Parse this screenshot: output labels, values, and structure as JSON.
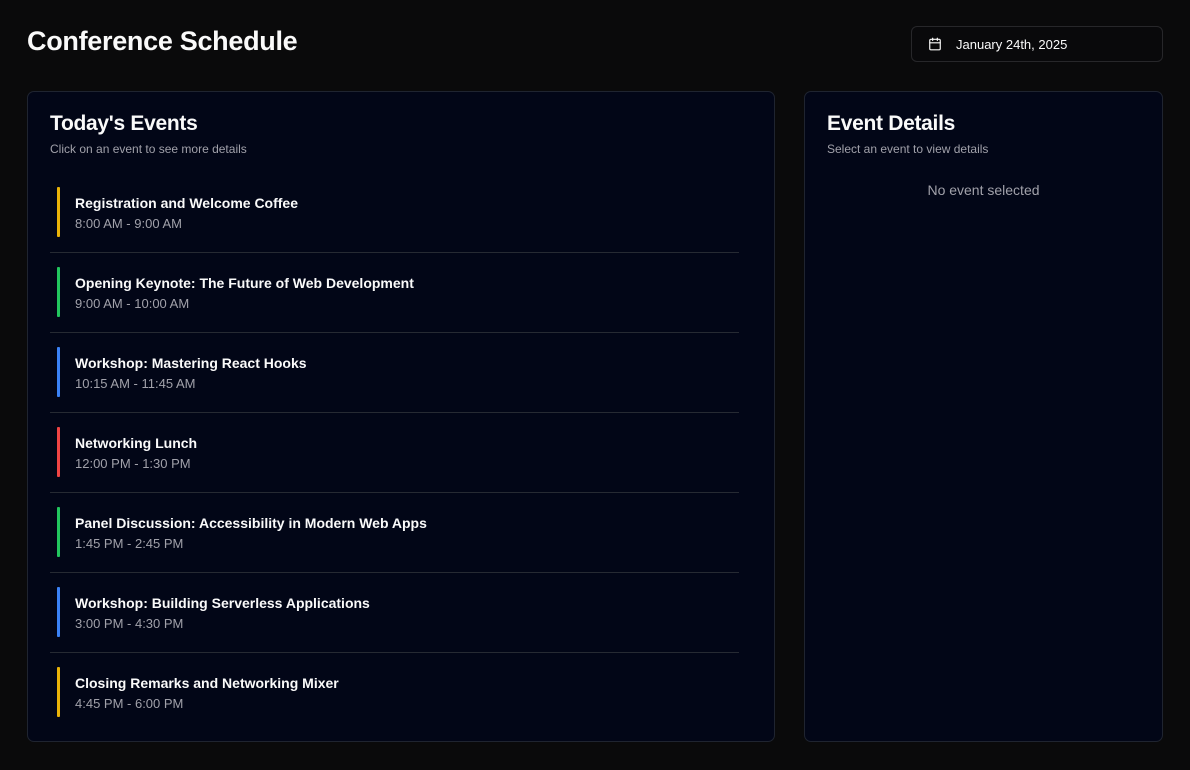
{
  "header": {
    "title": "Conference Schedule",
    "date_label": "January 24th, 2025",
    "date_icon": "calendar-icon"
  },
  "events_card": {
    "title": "Today's Events",
    "subtitle": "Click on an event to see more details",
    "items": [
      {
        "title": "Registration and Welcome Coffee",
        "time": "8:00 AM - 9:00 AM",
        "color": "#eab308"
      },
      {
        "title": "Opening Keynote: The Future of Web Development",
        "time": "9:00 AM - 10:00 AM",
        "color": "#22c55e"
      },
      {
        "title": "Workshop: Mastering React Hooks",
        "time": "10:15 AM - 11:45 AM",
        "color": "#3b82f6"
      },
      {
        "title": "Networking Lunch",
        "time": "12:00 PM - 1:30 PM",
        "color": "#ef4444"
      },
      {
        "title": "Panel Discussion: Accessibility in Modern Web Apps",
        "time": "1:45 PM - 2:45 PM",
        "color": "#22c55e"
      },
      {
        "title": "Workshop: Building Serverless Applications",
        "time": "3:00 PM - 4:30 PM",
        "color": "#3b82f6"
      },
      {
        "title": "Closing Remarks and Networking Mixer",
        "time": "4:45 PM - 6:00 PM",
        "color": "#eab308"
      }
    ]
  },
  "details_card": {
    "title": "Event Details",
    "subtitle": "Select an event to view details",
    "empty_message": "No event selected"
  }
}
